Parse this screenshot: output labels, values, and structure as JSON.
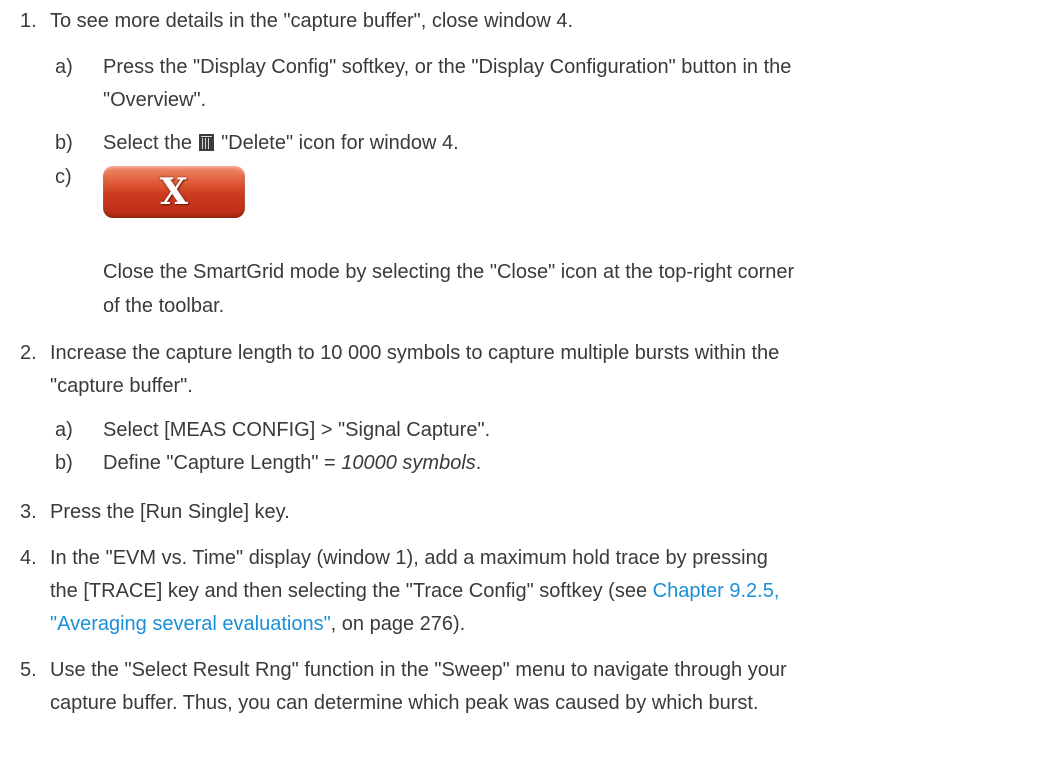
{
  "steps": [
    {
      "number": "1.",
      "text": "To see more details in the \"capture buffer\", close window 4.",
      "substeps": [
        {
          "letter": "a)",
          "line1": "Press the \"Display Config\" softkey, or the \"Display Configuration\" button in the",
          "line2": "\"Overview\"."
        },
        {
          "letter": "b)",
          "pre": "Select the ",
          "icon": "trash-icon",
          "post": " \"Delete\" icon for window 4."
        },
        {
          "letter": "c)",
          "button_glyph": "X",
          "line1": "Close the SmartGrid mode by selecting the \"Close\" icon at the top-right corner",
          "line2": "of the toolbar."
        }
      ]
    },
    {
      "number": "2.",
      "line1": "Increase the capture length to 10 000 symbols to capture multiple bursts within the",
      "line2": "\"capture buffer\".",
      "substeps": [
        {
          "letter": "a)",
          "text": "Select [MEAS CONFIG] > \"Signal Capture\"."
        },
        {
          "letter": "b)",
          "pre": "Define \"Capture Length\" = ",
          "italic": "10000 symbols",
          "post": "."
        }
      ]
    },
    {
      "number": "3.",
      "text": "Press the [Run Single] key."
    },
    {
      "number": "4.",
      "line1": "In the \"EVM vs. Time\" display (window 1), add a maximum hold trace by pressing",
      "line2_pre": "the [TRACE] key and then selecting the \"Trace Config\" softkey (see ",
      "line2_link": "Chapter 9.2.5,",
      "line3_link": "\"Averaging several evaluations\"",
      "line3_post": ", on page 276)."
    },
    {
      "number": "5.",
      "line1": "Use the \"Select Result Rng\" function in the \"Sweep\" menu to navigate through your",
      "line2": "capture buffer. Thus, you can determine which peak was caused by which burst."
    }
  ]
}
